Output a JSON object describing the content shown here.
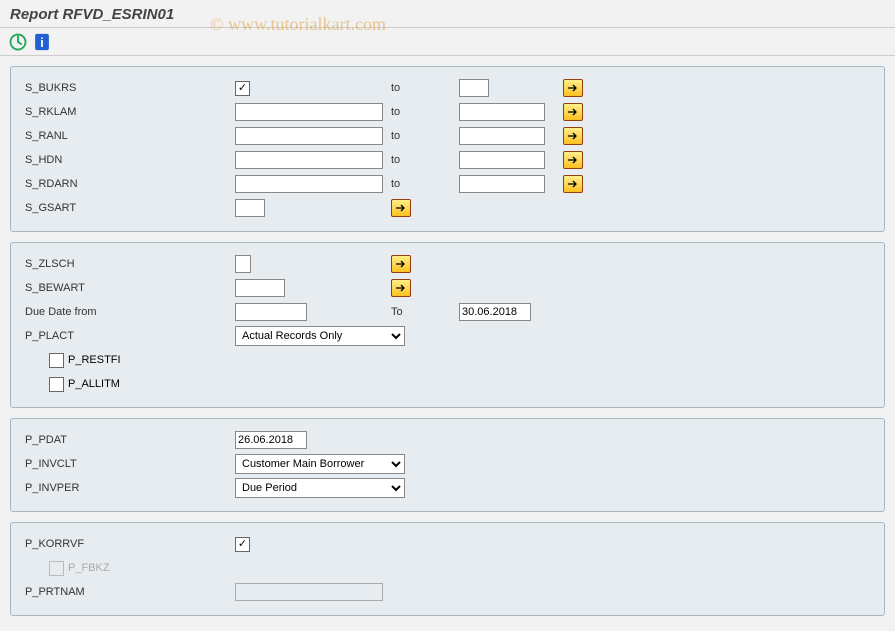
{
  "title": "Report RFVD_ESRIN01",
  "watermark": "© www.tutorialkart.com",
  "labels": {
    "to": "to",
    "To": "To"
  },
  "group1": {
    "s_bukrs": {
      "label": "S_BUKRS"
    },
    "s_rklam": {
      "label": "S_RKLAM"
    },
    "s_ranl": {
      "label": "S_RANL"
    },
    "s_hdn": {
      "label": "S_HDN"
    },
    "s_rdarn": {
      "label": "S_RDARN"
    },
    "s_gsart": {
      "label": "S_GSART"
    }
  },
  "group2": {
    "s_zlsch": {
      "label": "S_ZLSCH"
    },
    "s_bewart": {
      "label": "S_BEWART"
    },
    "due_date_from": {
      "label": "Due Date from"
    },
    "due_date_to": "30.06.2018",
    "p_plact": {
      "label": "P_PLACT",
      "value": "Actual Records Only"
    },
    "p_restfi": {
      "label": "P_RESTFI"
    },
    "p_allitm": {
      "label": "P_ALLITM"
    }
  },
  "group3": {
    "p_pdat": {
      "label": "P_PDAT",
      "value": "26.06.2018"
    },
    "p_invclt": {
      "label": "P_INVCLT",
      "value": "Customer Main Borrower"
    },
    "p_invper": {
      "label": "P_INVPER",
      "value": "Due Period"
    }
  },
  "group4": {
    "p_korrvf": {
      "label": "P_KORRVF"
    },
    "p_fbkz": {
      "label": "P_FBKZ"
    },
    "p_prtnam": {
      "label": "P_PRTNAM"
    }
  }
}
